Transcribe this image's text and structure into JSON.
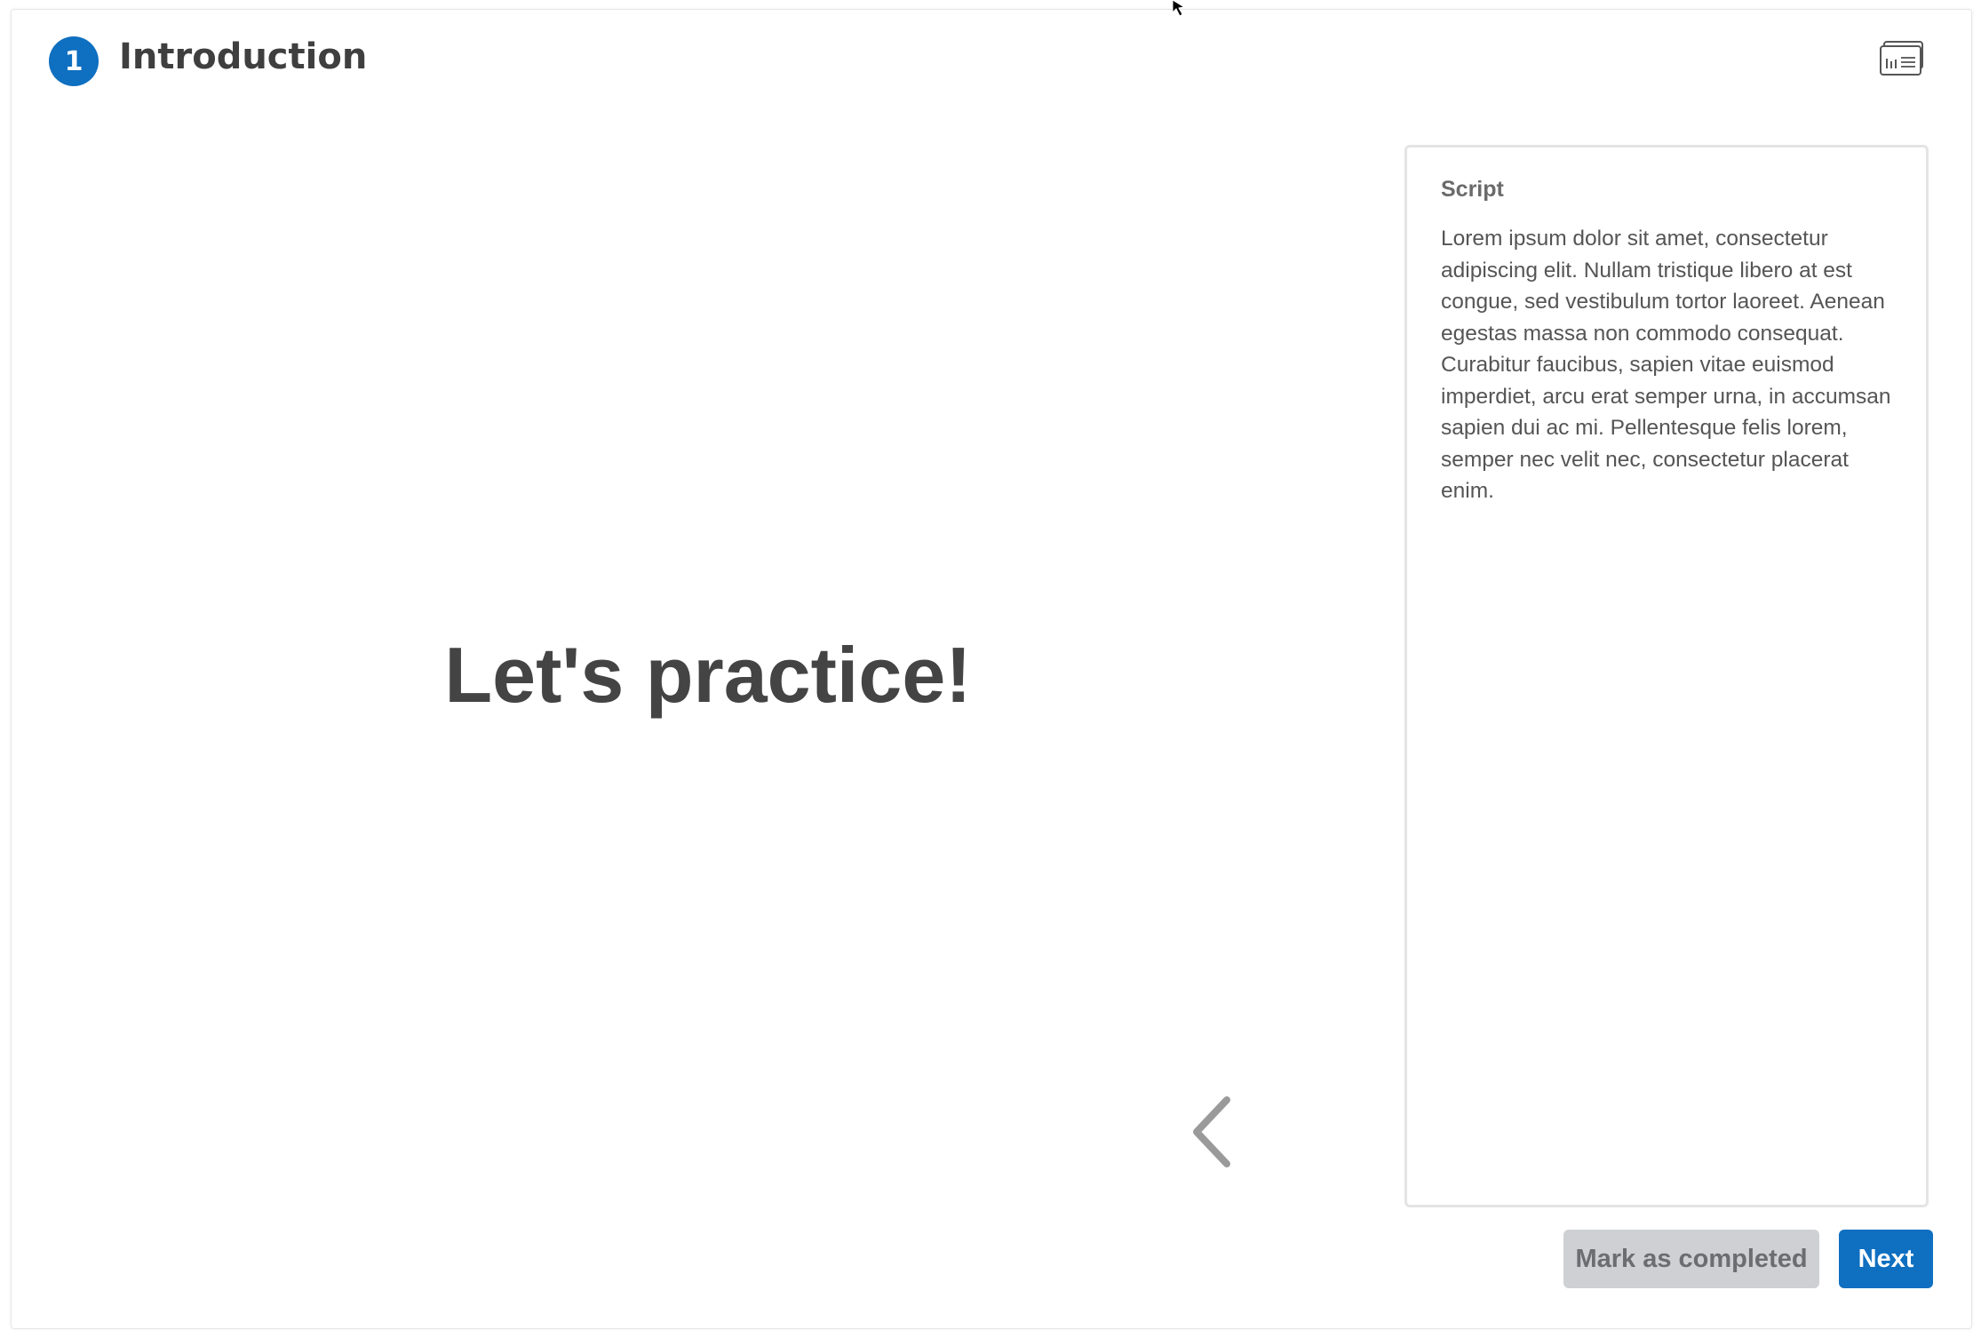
{
  "header": {
    "step_number": "1",
    "title": "Introduction",
    "icon": "slides-list-icon"
  },
  "slide": {
    "heading": "Let's practice!",
    "prev_icon": "chevron-left-icon"
  },
  "script": {
    "title": "Script",
    "body": "Lorem ipsum dolor sit amet, consectetur adipiscing elit. Nullam tristique libero at est congue, sed vestibulum tortor laoreet. Aenean egestas massa non commodo consequat. Curabitur faucibus, sapien vitae euismod imperdiet, arcu erat semper urna, in accumsan sapien dui ac mi. Pellentesque felis lorem, semper nec velit nec, consectetur placerat enim."
  },
  "actions": {
    "mark_completed_label": "Mark as completed",
    "next_label": "Next"
  },
  "colors": {
    "accent": "#0f6fc0",
    "title_text": "#3f3f3f",
    "disabled_button_bg": "#cfd0d3"
  }
}
